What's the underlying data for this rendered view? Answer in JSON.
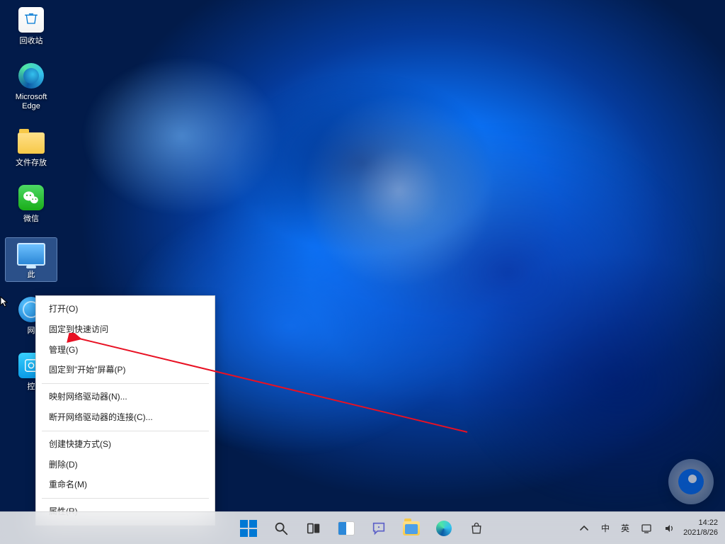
{
  "desktop_icons": [
    {
      "id": "recycle-bin",
      "label": "回收站"
    },
    {
      "id": "edge",
      "label": "Microsoft Edge"
    },
    {
      "id": "folder-files",
      "label": "文件存放"
    },
    {
      "id": "wechat",
      "label": "微信"
    },
    {
      "id": "this-pc",
      "label": "此"
    },
    {
      "id": "network",
      "label": "网"
    },
    {
      "id": "control-panel",
      "label": "控"
    }
  ],
  "selected_icon": "this-pc",
  "context_menu": {
    "target": "this-pc",
    "groups": [
      [
        "打开(O)",
        "固定到快速访问",
        "管理(G)",
        "固定到\"开始\"屏幕(P)"
      ],
      [
        "映射网络驱动器(N)...",
        "断开网络驱动器的连接(C)..."
      ],
      [
        "创建快捷方式(S)",
        "删除(D)",
        "重命名(M)"
      ],
      [
        "属性(R)"
      ]
    ],
    "highlighted_item": "管理(G)"
  },
  "annotation": {
    "type": "arrow",
    "color": "#e81123",
    "points_to": "管理(G)"
  },
  "taskbar": {
    "center_items": [
      {
        "id": "start",
        "name": "start-button"
      },
      {
        "id": "search",
        "name": "search-button"
      },
      {
        "id": "task-view",
        "name": "task-view-button"
      },
      {
        "id": "widgets",
        "name": "widgets-button"
      },
      {
        "id": "chat",
        "name": "chat-button"
      },
      {
        "id": "file-explorer",
        "name": "file-explorer-button"
      },
      {
        "id": "edge",
        "name": "edge-taskbar-button"
      },
      {
        "id": "store",
        "name": "store-button"
      }
    ],
    "tray": {
      "chevron": "^",
      "ime_icons": [
        "中",
        "英"
      ],
      "network": true,
      "volume": true
    },
    "clock": {
      "time": "14:22",
      "date": "2021/8/26"
    }
  }
}
